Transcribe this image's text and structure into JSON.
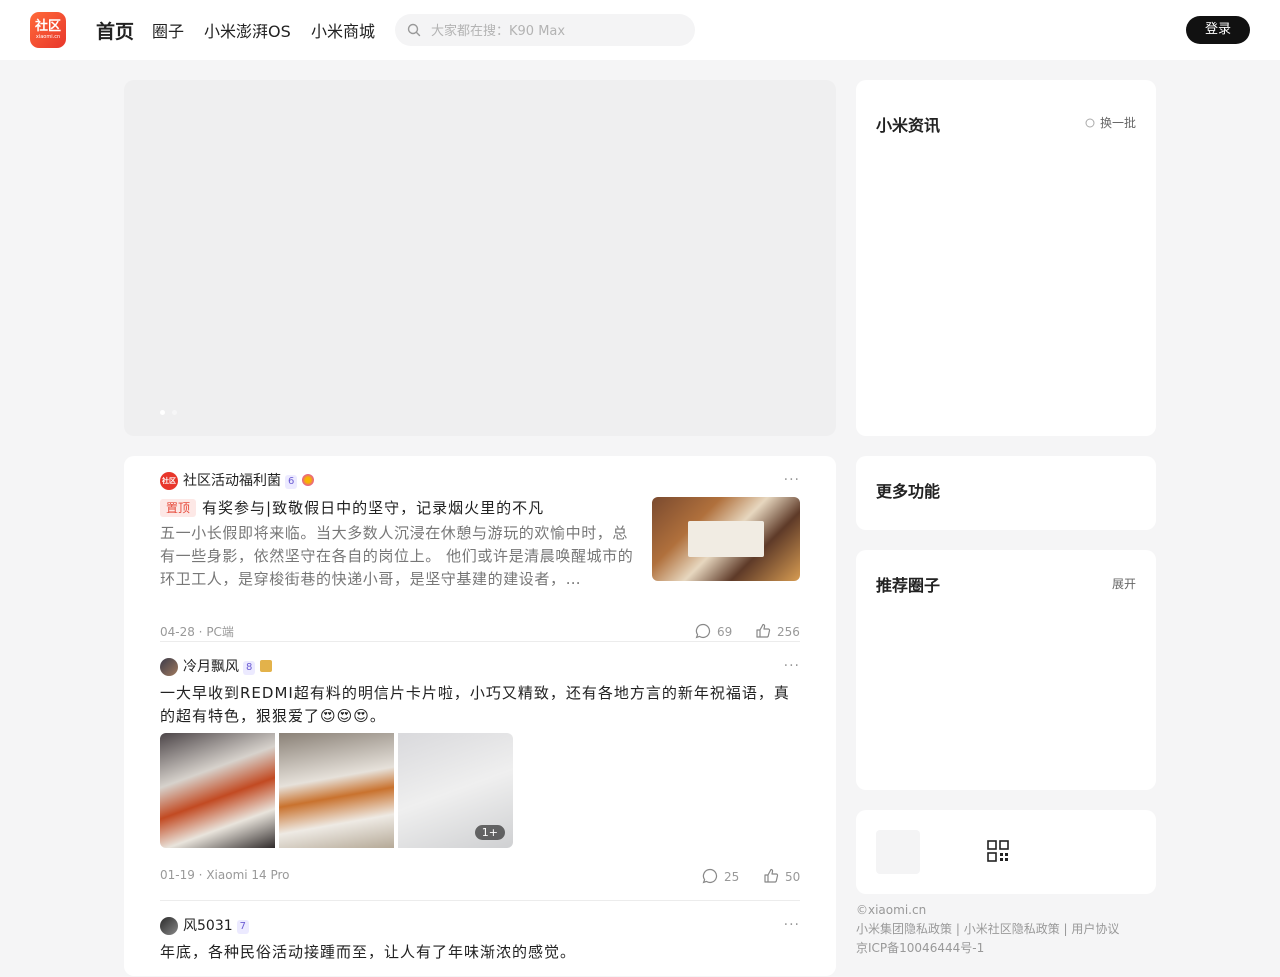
{
  "header": {
    "logo_text": "社区",
    "logo_sub": "xiaomi.cn",
    "nav": [
      "首页",
      "圈子",
      "小米澎湃OS",
      "小米商城"
    ],
    "search_placeholder": "大家都在搜：K90 Max",
    "login_label": "登录"
  },
  "sidebar": {
    "news_title": "小米资讯",
    "news_refresh": "换一批",
    "more_title": "更多功能",
    "circles_title": "推荐圈子",
    "circles_expand": "展开"
  },
  "footer": {
    "copyright": "©xiaomi.cn",
    "links": [
      "小米集团隐私政策",
      "小米社区隐私政策",
      "用户协议"
    ],
    "icp": "京ICP备10046444号-1"
  },
  "posts": [
    {
      "author": "社区活动福利菌",
      "level": "6",
      "pinned_label": "置顶",
      "title": "有奖参与|致敬假日中的坚守，记录烟火里的不凡",
      "excerpt": "五一小长假即将来临。当大多数人沉浸在休憩与游玩的欢愉中时，总有一些身影，依然坚守在各自的岗位上。 他们或许是清晨唤醒城市的环卫工人，是穿梭街巷的快递小哥，是坚守基建的建设者，…",
      "meta": "04-28 · PC端",
      "comments": "69",
      "likes": "256"
    },
    {
      "author": "冷月飘风",
      "level": "8",
      "title": "一大早收到REDMI超有料的明信片卡片啦，小巧又精致，还有各地方言的新年祝福语，真的超有特色，狠狠爱了😍😍😍。",
      "image_more": "1+",
      "meta": "01-19 · Xiaomi 14 Pro",
      "comments": "25",
      "likes": "50"
    },
    {
      "author": "风5031",
      "level": "7",
      "title": "年底，各种民俗活动接踵而至，让人有了年味渐浓的感觉。"
    }
  ],
  "colors": {
    "brand": "#e8362b",
    "login_bg": "#111111",
    "pin_text": "#e64a3b"
  },
  "icons": [
    "search-icon",
    "comment-icon",
    "like-icon",
    "qrcode-icon",
    "refresh-icon",
    "more-icon"
  ]
}
